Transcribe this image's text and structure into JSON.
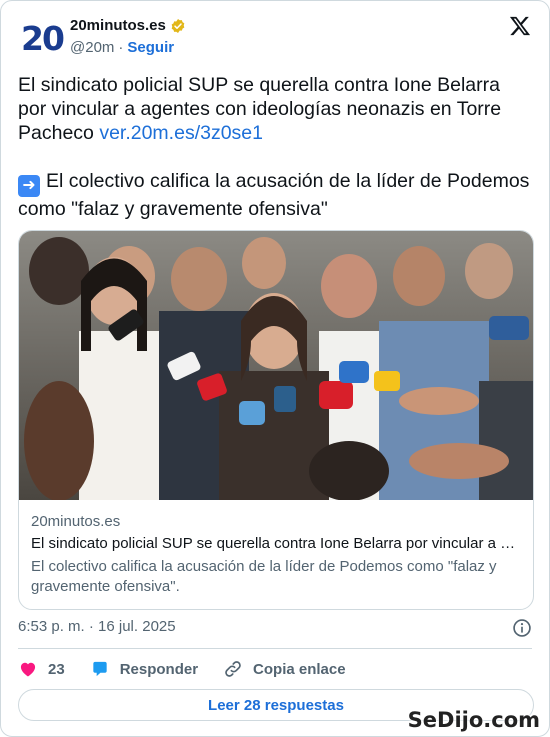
{
  "account": {
    "logo_text": "20",
    "name": "20minutos.es",
    "handle": "@20m",
    "separator": "·",
    "follow_label": "Seguir"
  },
  "tweet": {
    "paragraph1": "El sindicato policial SUP se querella contra Ione Belarra por vincular a agentes con ideologías neonazis en Torre Pacheco ",
    "link": "ver.20m.es/3z0se1",
    "paragraph2": "El colectivo califica la acusación de la líder de Podemos como \"falaz y gravemente ofensiva\"",
    "arrow_emoji": "➡"
  },
  "link_card": {
    "domain": "20minutos.es",
    "title": "El sindicato policial SUP se querella contra Ione Belarra por vincular a …",
    "description": "El colectivo califica la acusación de la líder de Podemos como \"falaz y gravemente ofensiva\"."
  },
  "meta": {
    "timestamp": "6:53 p. m. · 16 jul. 2025"
  },
  "actions": {
    "likes": "23",
    "reply_label": "Responder",
    "copy_label": "Copia enlace"
  },
  "read_replies_label": "Leer 28 respuestas",
  "watermark": "SeDijo.com",
  "colors": {
    "link": "#1d6fd8",
    "like": "#f91880",
    "reply": "#1d9bf0",
    "verified": "#e2b719"
  },
  "icons": [
    "verified-icon",
    "x-logo-icon",
    "arrow-right-icon",
    "info-icon",
    "heart-icon",
    "reply-bubble-icon",
    "link-icon"
  ]
}
